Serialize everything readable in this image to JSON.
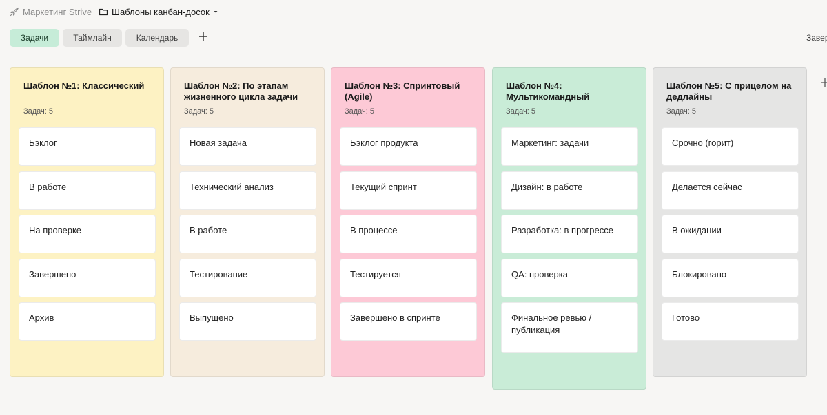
{
  "breadcrumb": {
    "root": "Маркетинг Strive",
    "current": "Шаблоны канбан-досок"
  },
  "tabs": [
    {
      "label": "Задачи",
      "active": true
    },
    {
      "label": "Таймлайн",
      "active": false
    },
    {
      "label": "Календарь",
      "active": false
    }
  ],
  "right_label": "Завер",
  "colors": {
    "tab_active": "#c6ecd8",
    "col1": "#fdf2c3",
    "col2": "#f6ecdd",
    "col3": "#fdc9d6",
    "col4": "#c9ecd7",
    "col5": "#e5e5e4"
  },
  "columns": [
    {
      "title": "Шаблон №1: Классический",
      "count": "Задач: 5",
      "cards": [
        "Бэклог",
        "В работе",
        "На проверке",
        "Завершено",
        "Архив"
      ]
    },
    {
      "title": "Шаблон №2: По этапам жизненного цикла задачи",
      "count": "Задач: 5",
      "cards": [
        "Новая задача",
        "Технический анализ",
        "В работе",
        "Тестирование",
        "Выпущено"
      ]
    },
    {
      "title": "Шаблон №3: Спринтовый (Agile)",
      "count": "Задач: 5",
      "cards": [
        "Бэклог продукта",
        "Текущий спринт",
        "В процессе",
        "Тестируется",
        "Завершено в спринте"
      ]
    },
    {
      "title": "Шаблон №4: Мультикомандный",
      "count": "Задач: 5",
      "cards": [
        "Маркетинг: задачи",
        "Дизайн: в работе",
        "Разработка: в прогрессе",
        "QA: проверка",
        "Финальное ревью / публикация"
      ]
    },
    {
      "title": "Шаблон №5: С прицелом на дедлайны",
      "count": "Задач: 5",
      "cards": [
        "Срочно (горит)",
        "Делается сейчас",
        "В ожидании",
        "Блокировано",
        "Готово"
      ]
    }
  ]
}
